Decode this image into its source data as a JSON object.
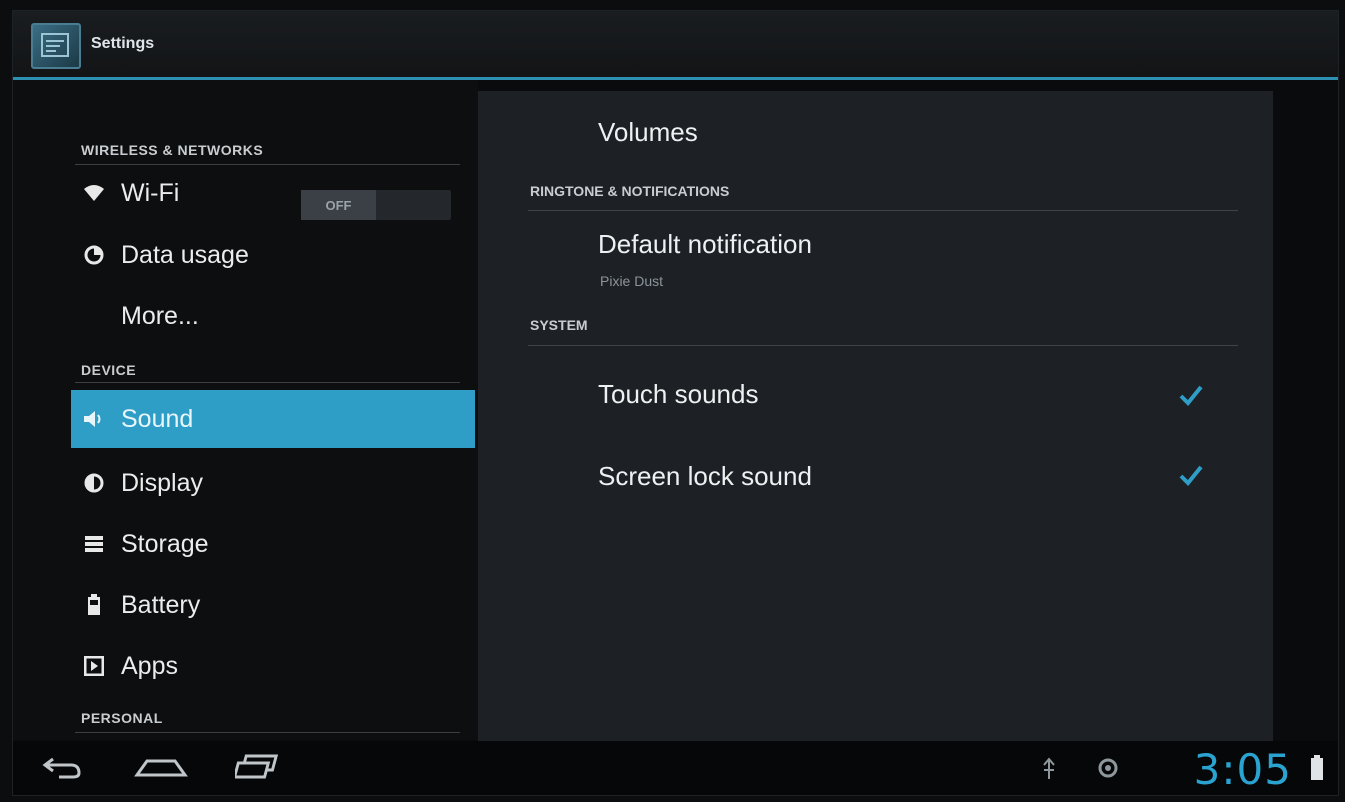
{
  "window": {
    "title": "Settings"
  },
  "sidebar": {
    "sections": [
      {
        "header": "WIRELESS & NETWORKS"
      },
      {
        "header": "DEVICE"
      },
      {
        "header": "PERSONAL"
      }
    ],
    "items": [
      {
        "label": "Wi-Fi",
        "icon": "wifi-icon"
      },
      {
        "label": "Data usage",
        "icon": "data-usage-icon"
      },
      {
        "label": "More...",
        "icon": ""
      },
      {
        "label": "Sound",
        "icon": "speaker-icon",
        "selected": true
      },
      {
        "label": "Display",
        "icon": "display-icon"
      },
      {
        "label": "Storage",
        "icon": "storage-icon"
      },
      {
        "label": "Battery",
        "icon": "battery-icon"
      },
      {
        "label": "Apps",
        "icon": "apps-icon"
      }
    ],
    "wifi_toggle": "OFF"
  },
  "content": {
    "volumes": "Volumes",
    "ringtone_header": "RINGTONE & NOTIFICATIONS",
    "default_notification": {
      "title": "Default notification",
      "summary": "Pixie Dust"
    },
    "system_header": "SYSTEM",
    "touch_sounds": {
      "label": "Touch sounds",
      "checked": true
    },
    "screen_lock_sound": {
      "label": "Screen lock sound",
      "checked": true
    }
  },
  "status_bar": {
    "time": "3:05"
  },
  "colors": {
    "accent": "#2e9ec7",
    "clock": "#2aa3d0"
  }
}
